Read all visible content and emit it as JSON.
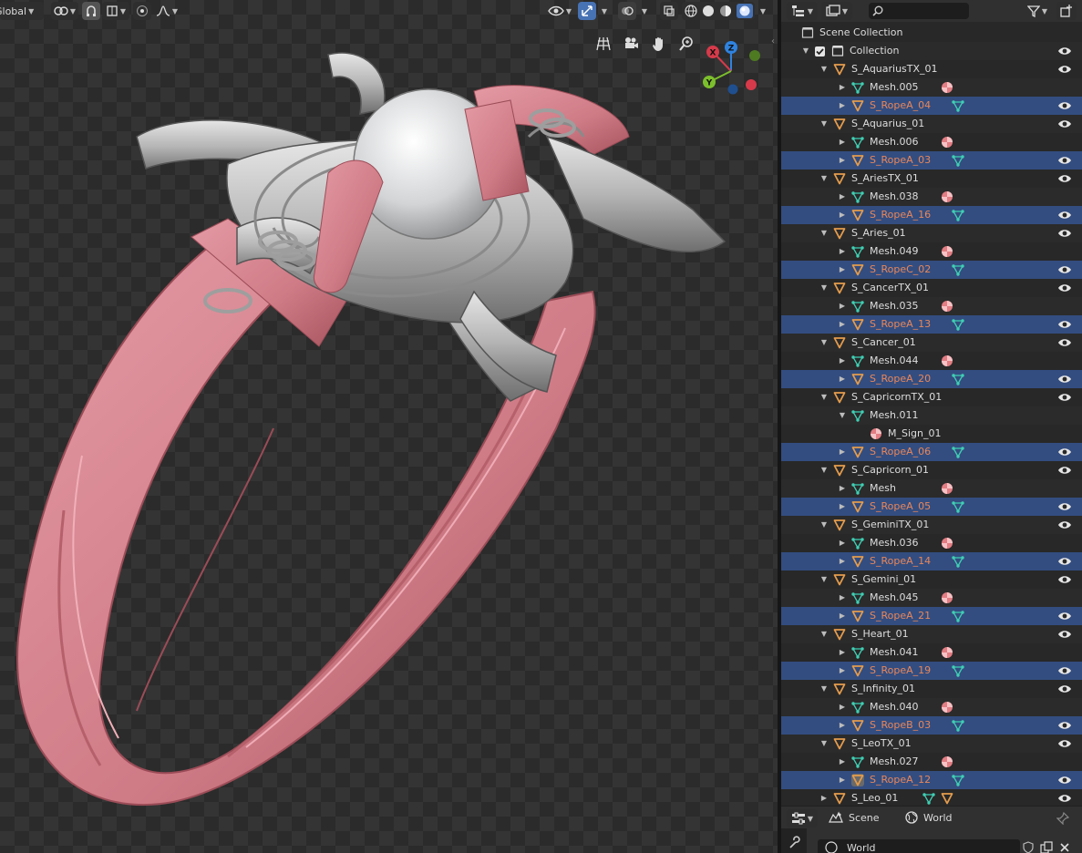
{
  "viewport": {
    "transform_orientation": "Global",
    "icons": [
      "transform-pivot-icon",
      "snap-icon",
      "snap-target-icon",
      "proportional-edit-icon",
      "falloff-icon",
      "visibility-icon",
      "gizmo-icon",
      "overlay-icon",
      "xray-icon",
      "wireframe-shading-icon",
      "solid-shading-icon",
      "material-shading-icon",
      "rendered-shading-icon"
    ],
    "navigation": [
      "perspective-grid-icon",
      "camera-icon",
      "pan-hand-icon",
      "zoom-icon"
    ],
    "gizmo_axes": {
      "x": "X",
      "y": "Y",
      "z": "Z"
    },
    "colors": {
      "x_axis": "#d73a4a",
      "y_axis": "#7cbf2c",
      "z_axis": "#2f83e0",
      "metal": "#b9b9b9",
      "leather": "#d98a94"
    }
  },
  "outliner": {
    "search_placeholder": "",
    "root": "Scene Collection",
    "rows": [
      {
        "level": 1,
        "type": "collection",
        "label": "Collection",
        "expand": "down",
        "checkbox": true,
        "eye": true
      },
      {
        "level": 2,
        "type": "object",
        "label": "S_AquariusTX_01",
        "expand": "down",
        "eye": true
      },
      {
        "level": 3,
        "type": "mesh",
        "label": "Mesh.005",
        "expand": "right",
        "material_after": true
      },
      {
        "level": 3,
        "type": "object",
        "label": "S_RopeA_04",
        "expand": "right",
        "selected": true,
        "mesh_after": true,
        "eye": true
      },
      {
        "level": 2,
        "type": "object",
        "label": "S_Aquarius_01",
        "expand": "down",
        "eye": true
      },
      {
        "level": 3,
        "type": "mesh",
        "label": "Mesh.006",
        "expand": "right",
        "material_after": true
      },
      {
        "level": 3,
        "type": "object",
        "label": "S_RopeA_03",
        "expand": "right",
        "selected": true,
        "mesh_after": true,
        "eye": true
      },
      {
        "level": 2,
        "type": "object",
        "label": "S_AriesTX_01",
        "expand": "down",
        "eye": true
      },
      {
        "level": 3,
        "type": "mesh",
        "label": "Mesh.038",
        "expand": "right",
        "material_after": true
      },
      {
        "level": 3,
        "type": "object",
        "label": "S_RopeA_16",
        "expand": "right",
        "selected": true,
        "mesh_after": true,
        "eye": true
      },
      {
        "level": 2,
        "type": "object",
        "label": "S_Aries_01",
        "expand": "down",
        "eye": true
      },
      {
        "level": 3,
        "type": "mesh",
        "label": "Mesh.049",
        "expand": "right",
        "material_after": true
      },
      {
        "level": 3,
        "type": "object",
        "label": "S_RopeC_02",
        "expand": "right",
        "selected": true,
        "mesh_after": true,
        "eye": true
      },
      {
        "level": 2,
        "type": "object",
        "label": "S_CancerTX_01",
        "expand": "down",
        "eye": true
      },
      {
        "level": 3,
        "type": "mesh",
        "label": "Mesh.035",
        "expand": "right",
        "material_after": true
      },
      {
        "level": 3,
        "type": "object",
        "label": "S_RopeA_13",
        "expand": "right",
        "selected": true,
        "mesh_after": true,
        "eye": true
      },
      {
        "level": 2,
        "type": "object",
        "label": "S_Cancer_01",
        "expand": "down",
        "eye": true
      },
      {
        "level": 3,
        "type": "mesh",
        "label": "Mesh.044",
        "expand": "right",
        "material_after": true
      },
      {
        "level": 3,
        "type": "object",
        "label": "S_RopeA_20",
        "expand": "right",
        "selected": true,
        "mesh_after": true,
        "eye": true
      },
      {
        "level": 2,
        "type": "object",
        "label": "S_CapricornTX_01",
        "expand": "down",
        "eye": true
      },
      {
        "level": 3,
        "type": "mesh",
        "label": "Mesh.011",
        "expand": "down"
      },
      {
        "level": 4,
        "type": "material",
        "label": "M_Sign_01"
      },
      {
        "level": 3,
        "type": "object",
        "label": "S_RopeA_06",
        "expand": "right",
        "selected": true,
        "mesh_after": true,
        "eye": true
      },
      {
        "level": 2,
        "type": "object",
        "label": "S_Capricorn_01",
        "expand": "down",
        "eye": true
      },
      {
        "level": 3,
        "type": "mesh",
        "label": "Mesh",
        "expand": "right",
        "material_after": true
      },
      {
        "level": 3,
        "type": "object",
        "label": "S_RopeA_05",
        "expand": "right",
        "selected": true,
        "mesh_after": true,
        "eye": true
      },
      {
        "level": 2,
        "type": "object",
        "label": "S_GeminiTX_01",
        "expand": "down",
        "eye": true
      },
      {
        "level": 3,
        "type": "mesh",
        "label": "Mesh.036",
        "expand": "right",
        "material_after": true
      },
      {
        "level": 3,
        "type": "object",
        "label": "S_RopeA_14",
        "expand": "right",
        "selected": true,
        "mesh_after": true,
        "eye": true
      },
      {
        "level": 2,
        "type": "object",
        "label": "S_Gemini_01",
        "expand": "down",
        "eye": true
      },
      {
        "level": 3,
        "type": "mesh",
        "label": "Mesh.045",
        "expand": "right",
        "material_after": true
      },
      {
        "level": 3,
        "type": "object",
        "label": "S_RopeA_21",
        "expand": "right",
        "selected": true,
        "mesh_after": true,
        "eye": true
      },
      {
        "level": 2,
        "type": "object",
        "label": "S_Heart_01",
        "expand": "down",
        "eye": true
      },
      {
        "level": 3,
        "type": "mesh",
        "label": "Mesh.041",
        "expand": "right",
        "material_after": true
      },
      {
        "level": 3,
        "type": "object",
        "label": "S_RopeA_19",
        "expand": "right",
        "selected": true,
        "mesh_after": true,
        "eye": true
      },
      {
        "level": 2,
        "type": "object",
        "label": "S_Infinity_01",
        "expand": "down",
        "eye": true
      },
      {
        "level": 3,
        "type": "mesh",
        "label": "Mesh.040",
        "expand": "right",
        "material_after": true
      },
      {
        "level": 3,
        "type": "object",
        "label": "S_RopeB_03",
        "expand": "right",
        "selected": true,
        "mesh_after": true,
        "eye": true
      },
      {
        "level": 2,
        "type": "object",
        "label": "S_LeoTX_01",
        "expand": "down",
        "eye": true
      },
      {
        "level": 3,
        "type": "mesh",
        "label": "Mesh.027",
        "expand": "right",
        "material_after": true
      },
      {
        "level": 3,
        "type": "object",
        "label": "S_RopeA_12",
        "expand": "right",
        "selected": true,
        "active": true,
        "mesh_after": true,
        "eye": true
      },
      {
        "level": 2,
        "type": "object",
        "label": "S_Leo_01",
        "expand": "right",
        "mesh_after": true,
        "object_after": true,
        "eye": true
      }
    ]
  },
  "properties": {
    "tabs": [
      {
        "label": "Scene",
        "icon": "scene-icon"
      },
      {
        "label": "World",
        "icon": "world-icon"
      }
    ],
    "world_field": "World"
  }
}
